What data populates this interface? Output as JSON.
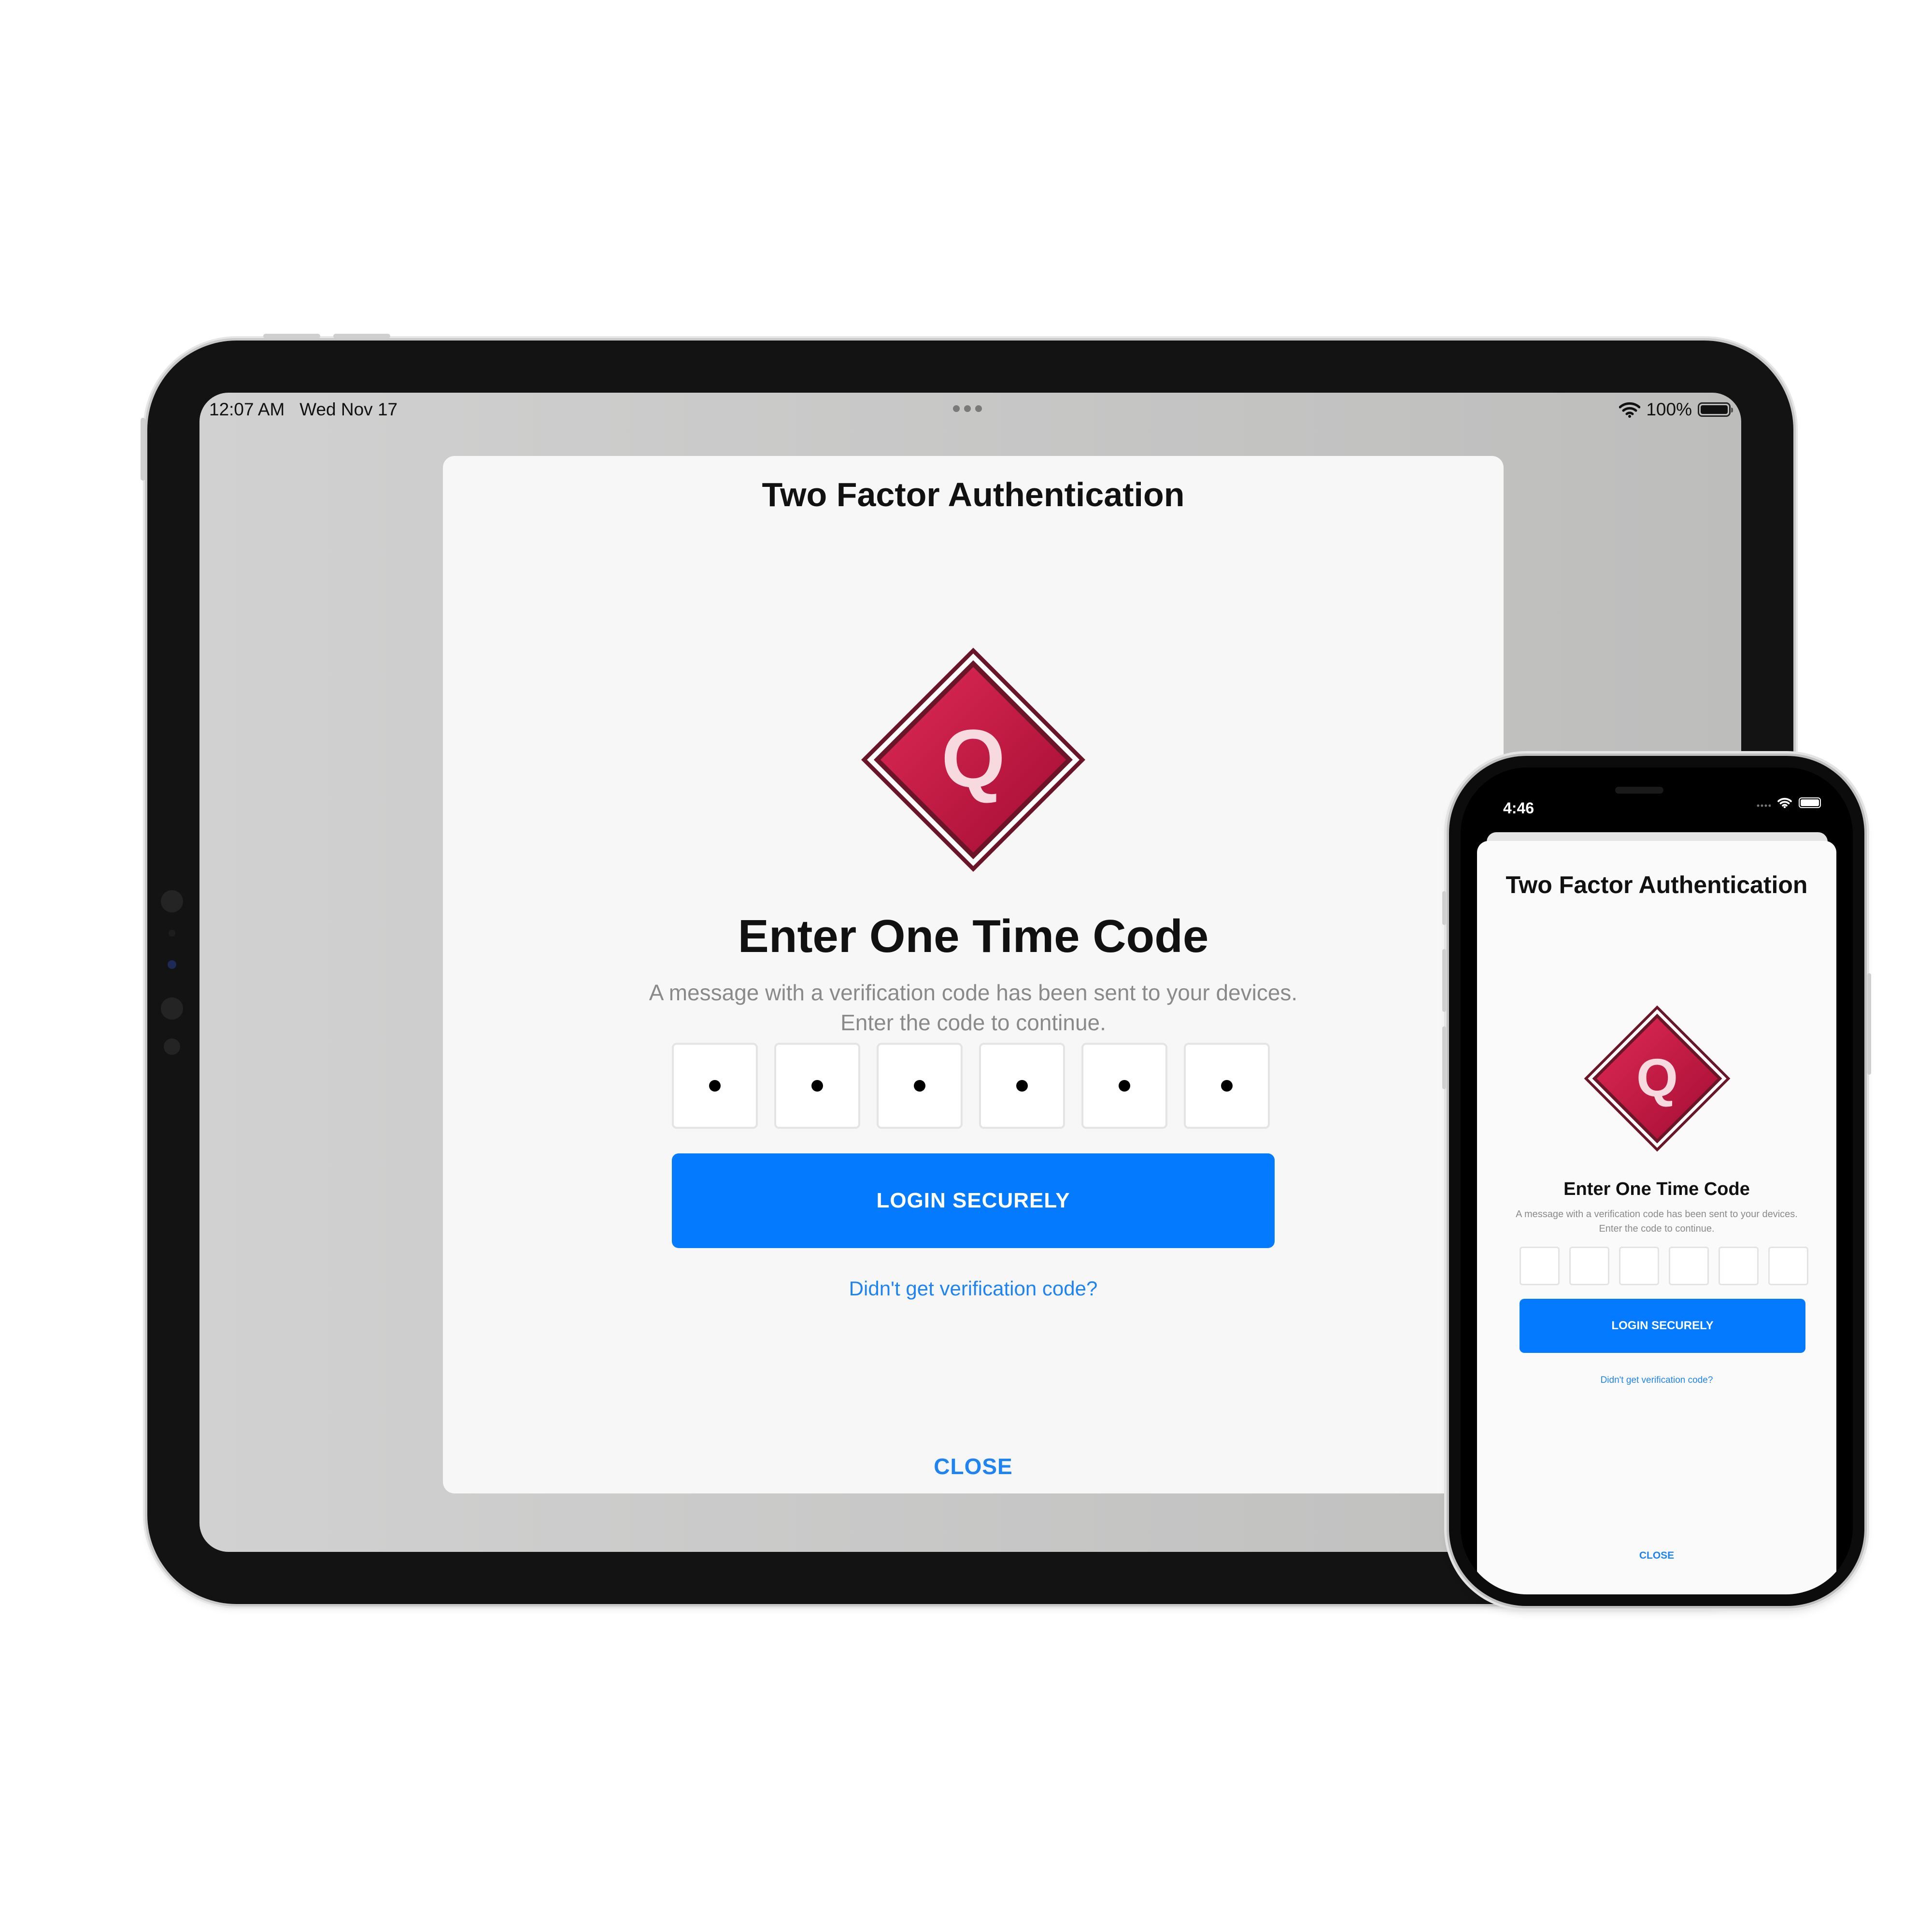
{
  "ipad": {
    "status": {
      "time": "12:07 AM",
      "date": "Wed Nov 17",
      "battery": "100%"
    },
    "modal": {
      "title": "Two Factor Authentication",
      "logo_letter": "Q",
      "heading": "Enter One Time Code",
      "description": "A message with a verification code has been sent to your devices. Enter the code to continue.",
      "code_digits": [
        "•",
        "•",
        "•",
        "•",
        "•",
        "•"
      ],
      "login_label": "LOGIN SECURELY",
      "resend_link": "Didn't get verification code?",
      "close_label": "CLOSE"
    }
  },
  "iphone": {
    "status": {
      "time": "4:46"
    },
    "modal": {
      "title": "Two Factor Authentication",
      "logo_letter": "Q",
      "heading": "Enter One Time Code",
      "description": "A message with a verification code has been sent to your devices. Enter the code to continue.",
      "code_digits": [
        "",
        "",
        "",
        "",
        "",
        ""
      ],
      "login_label": "LOGIN SECURELY",
      "resend_link": "Didn't get verification code?",
      "close_label": "CLOSE"
    }
  },
  "colors": {
    "accent": "#037aff",
    "link": "#1f84f3",
    "logo_red": "#c2133f",
    "logo_border": "#6b1529"
  },
  "icons": [
    "wifi-icon",
    "battery-icon",
    "multitasking-dots-icon",
    "q-diamond-logo"
  ]
}
